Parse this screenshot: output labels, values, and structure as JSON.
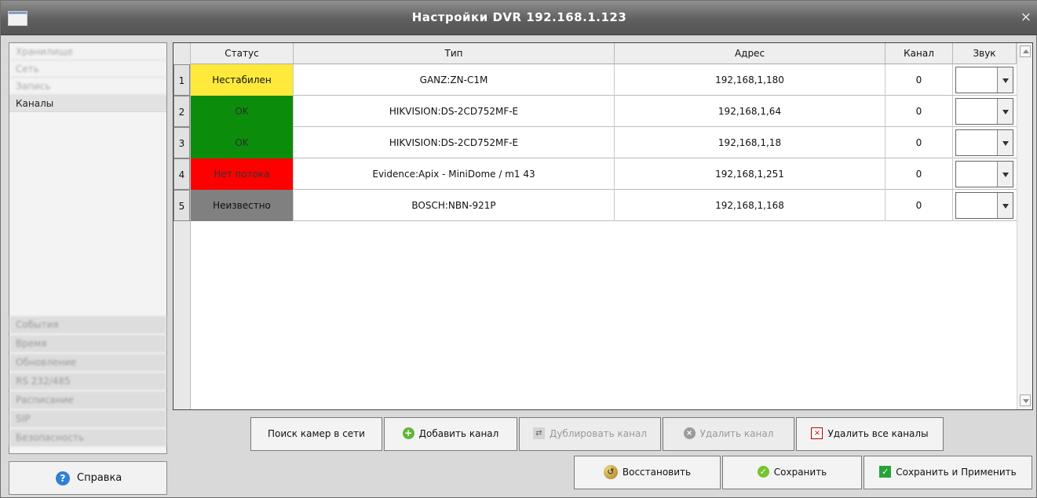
{
  "window": {
    "title": "Настройки DVR 192.168.1.123",
    "close_icon": "×"
  },
  "sidebar": {
    "items": [
      {
        "label": "Хранилище",
        "blurred": true
      },
      {
        "label": "Сеть",
        "blurred": true
      },
      {
        "label": "Запись",
        "blurred": true
      },
      {
        "label": "Каналы",
        "active": true
      },
      {
        "label": "События",
        "blurred": true
      },
      {
        "label": "Время",
        "blurred": true
      },
      {
        "label": "Обновление",
        "blurred": true
      },
      {
        "label": "RS 232/485",
        "blurred": true
      },
      {
        "label": "Расписание",
        "blurred": true
      },
      {
        "label": "SIP",
        "blurred": true
      },
      {
        "label": "Безопасность",
        "blurred": true
      }
    ]
  },
  "help": {
    "label": "Справка",
    "icon": "?"
  },
  "table": {
    "headers": [
      "Статус",
      "Тип",
      "Адрес",
      "Канал",
      "Звук"
    ],
    "rows": [
      {
        "num": "1",
        "status": "Нестабилен",
        "status_color": "#ffea3b",
        "type": "GANZ:ZN-C1M",
        "address": "192,168,1,180",
        "channel": "0"
      },
      {
        "num": "2",
        "status": "OK",
        "status_color": "#0b8d0b",
        "type": "HIKVISION:DS-2CD752MF-E",
        "address": "192,168,1,64",
        "channel": "0"
      },
      {
        "num": "3",
        "status": "OK",
        "status_color": "#0b8d0b",
        "type": "HIKVISION:DS-2CD752MF-E",
        "address": "192,168,1,18",
        "channel": "0"
      },
      {
        "num": "4",
        "status": "Нет потока",
        "status_color": "#ff0000",
        "type": "Evidence:Apix - MiniDome / m1 43",
        "address": "192,168,1,251",
        "channel": "0"
      },
      {
        "num": "5",
        "status": "Неизвестно",
        "status_color": "#808080",
        "type": "BOSCH:NBN-921P",
        "address": "192,168,1,168",
        "channel": "0"
      }
    ]
  },
  "actions": {
    "search": "Поиск камер в сети",
    "add": "Добавить канал",
    "duplicate": "Дублировать канал",
    "delete": "Удалить канал",
    "delete_all": "Удалить все каналы",
    "restore": "Восстановить",
    "save": "Сохранить",
    "save_apply": "Сохранить и Применить"
  }
}
